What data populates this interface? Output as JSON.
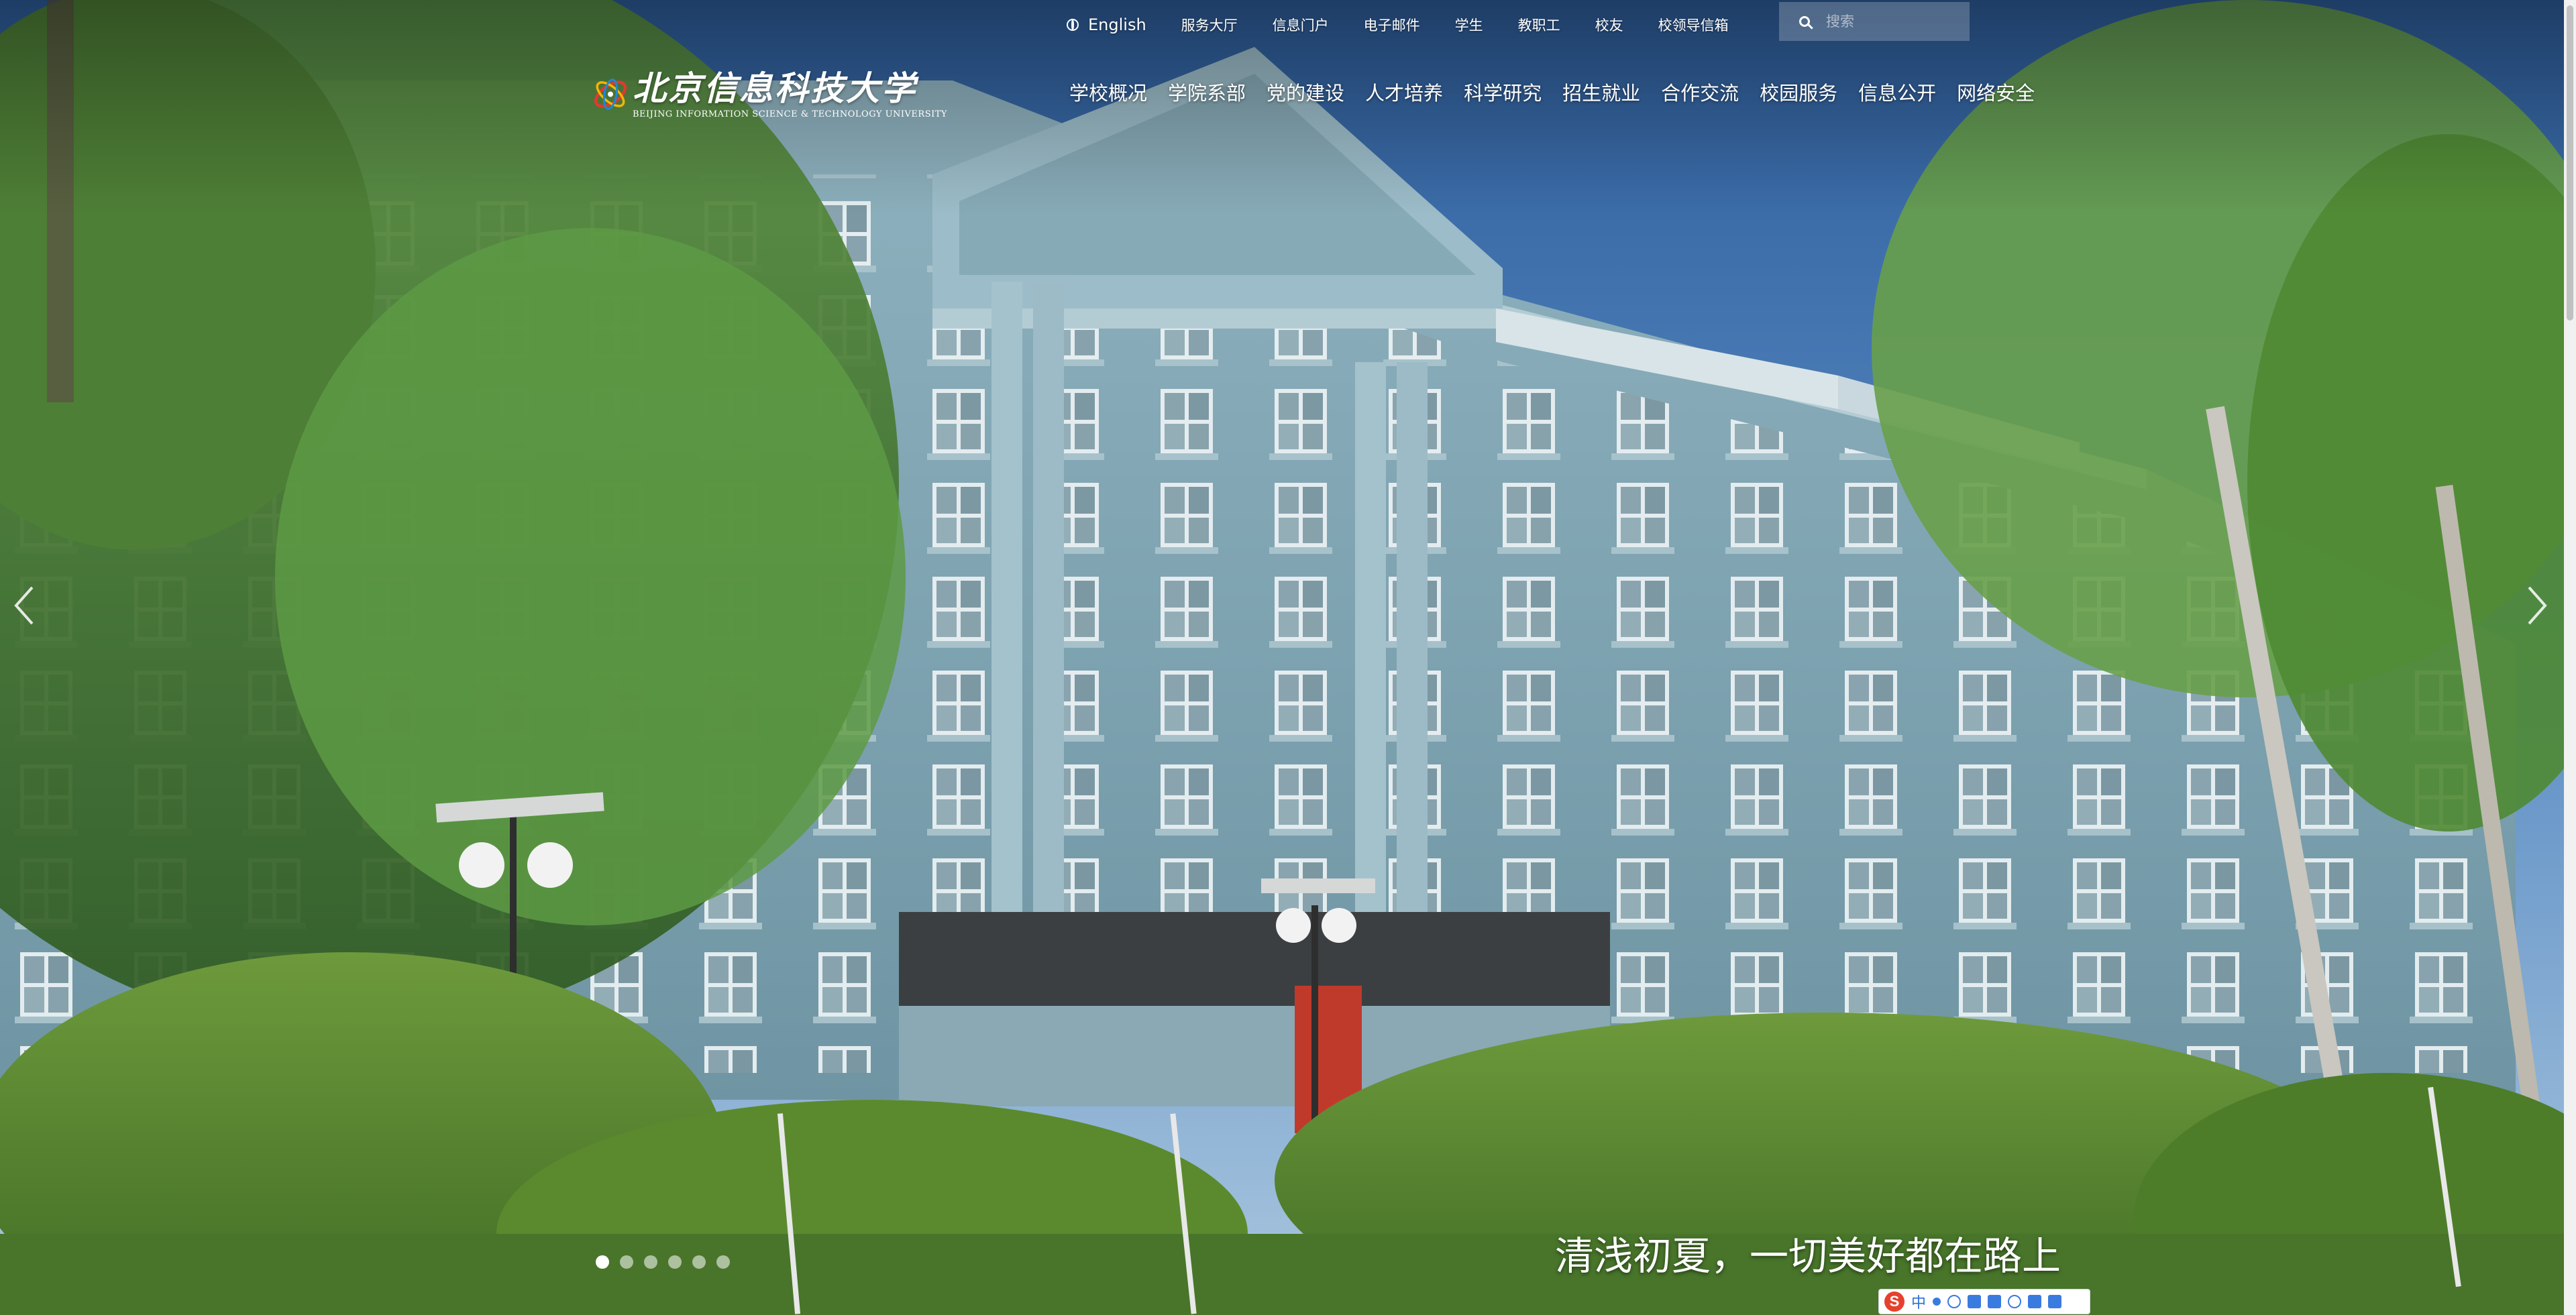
{
  "utility_bar": {
    "english": "English",
    "links": [
      "服务大厅",
      "信息门户",
      "电子邮件",
      "学生",
      "教职工",
      "校友",
      "校领导信箱"
    ],
    "search_placeholder": "搜索"
  },
  "logo": {
    "cn": "北京信息科技大学",
    "en": "BEIJING INFORMATION SCIENCE & TECHNOLOGY UNIVERSITY"
  },
  "nav": {
    "items": [
      "学校概况",
      "学院系部",
      "党的建设",
      "人才培养",
      "科学研究",
      "招生就业",
      "合作交流",
      "校园服务",
      "信息公开",
      "网络安全"
    ]
  },
  "slider": {
    "caption": "清浅初夏，一切美好都在路上",
    "dot_count": 6,
    "active_index": 0,
    "prev_icon": "chevron-left-icon",
    "next_icon": "chevron-right-icon"
  },
  "ime": {
    "brand": "S",
    "mode": "中"
  },
  "colors": {
    "building": "#7fa3b0",
    "sky": "#3f6fa8",
    "foliage": "#4f8a33"
  }
}
